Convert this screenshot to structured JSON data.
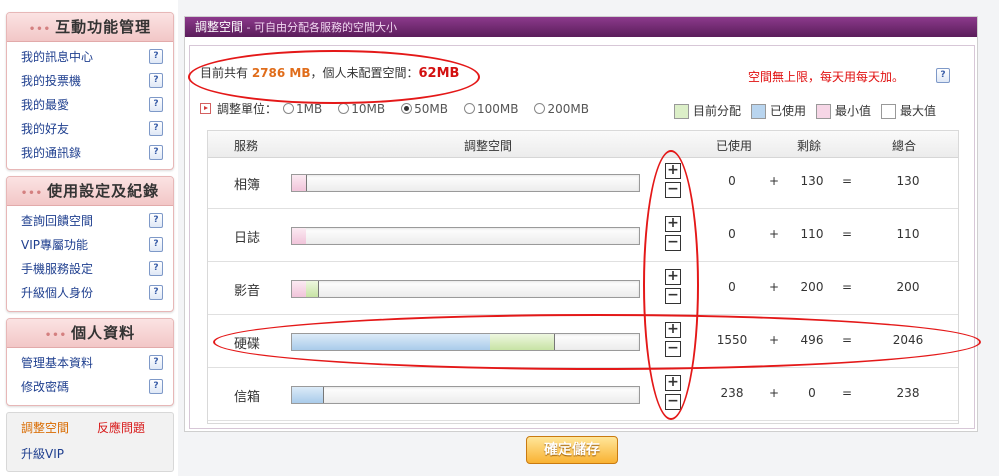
{
  "sidebar": {
    "sections": [
      {
        "title": "互動功能管理",
        "items": [
          "我的訊息中心",
          "我的投票機",
          "我的最愛",
          "我的好友",
          "我的通訊錄"
        ]
      },
      {
        "title": "使用設定及紀錄",
        "items": [
          "查詢回饋空間",
          "VIP專屬功能",
          "手機服務設定",
          "升級個人身份"
        ]
      },
      {
        "title": "個人資料",
        "items": [
          "管理基本資料",
          "修改密碼"
        ]
      }
    ],
    "help_glyph": "?",
    "bottom": {
      "adjust": "調整空間",
      "report": "反應問題",
      "upgrade": "升級VIP"
    }
  },
  "header": {
    "title": "調整空間",
    "subtitle": " - 可自由分配各服務的空間大小"
  },
  "summary": {
    "prefix": "目前共有 ",
    "total": "2786 MB",
    "middle": "，個人未配置空間：",
    "free": "62MB"
  },
  "unlimited_text": "空間無上限，每天用每天加。",
  "unit": {
    "label": "調整單位：",
    "options": [
      "1MB",
      "10MB",
      "50MB",
      "100MB",
      "200MB"
    ],
    "selected": "50MB"
  },
  "legend": [
    "目前分配",
    "已使用",
    "最小值",
    "最大值"
  ],
  "table": {
    "headers": {
      "service": "服務",
      "adjust": "調整空間",
      "used": "已使用",
      "remaining": "剩餘",
      "total": "總合"
    },
    "plus": "+",
    "minus": "−",
    "plus_sign": "+",
    "eq_sign": "=",
    "rows": [
      {
        "service": "相簿",
        "used": "0",
        "remaining": "130",
        "total": "130",
        "used_frac": 0.0,
        "alloc_frac": 0.04,
        "min_frac": 0.04
      },
      {
        "service": "日誌",
        "used": "0",
        "remaining": "110",
        "total": "110",
        "used_frac": 0.0,
        "alloc_frac": 0.0,
        "min_frac": 0.04
      },
      {
        "service": "影音",
        "used": "0",
        "remaining": "200",
        "total": "200",
        "used_frac": 0.0,
        "alloc_frac": 0.075,
        "min_frac": 0.04
      },
      {
        "service": "硬碟",
        "used": "1550",
        "remaining": "496",
        "total": "2046",
        "used_frac": 0.575,
        "alloc_frac": 0.76,
        "min_frac": 0.0
      },
      {
        "service": "信箱",
        "used": "238",
        "remaining": "0",
        "total": "238",
        "used_frac": 0.09,
        "alloc_frac": 0.09,
        "min_frac": 0.0
      }
    ]
  },
  "save_label": "確定儲存"
}
